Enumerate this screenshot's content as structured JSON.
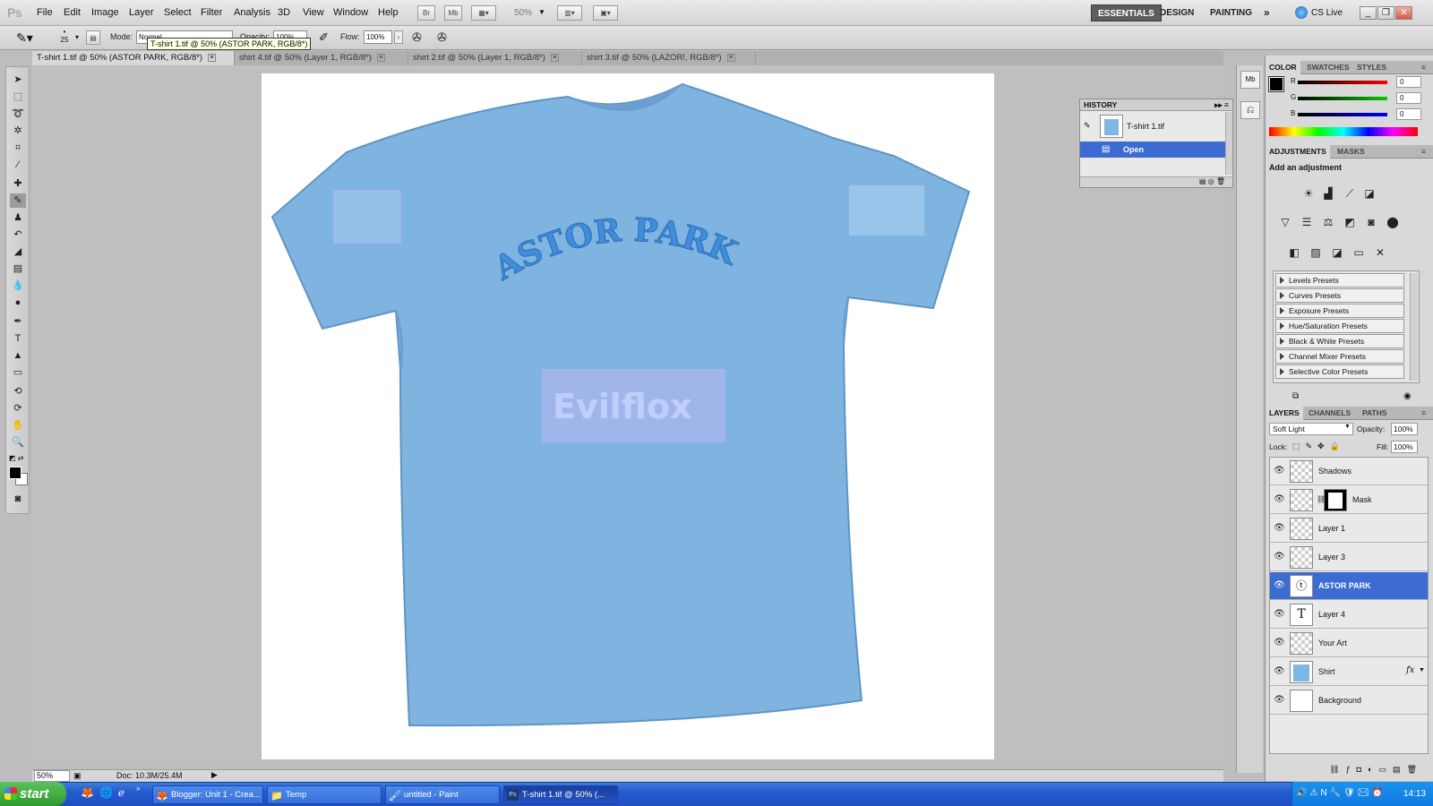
{
  "app": {
    "logo": "Ps"
  },
  "menu": [
    "File",
    "Edit",
    "Image",
    "Layer",
    "Select",
    "Filter",
    "Analysis",
    "3D",
    "View",
    "Window",
    "Help"
  ],
  "appbar": {
    "br": "Br",
    "mb": "Mb",
    "zoom": "50%"
  },
  "workspaces": [
    "ESSENTIALS",
    "DESIGN",
    "PAINTING",
    "»"
  ],
  "cslive": "CS Live",
  "options": {
    "brush_size": "25",
    "mode_label": "Mode:",
    "mode_value": "Normal",
    "opacity_label": "Opacity:",
    "opacity_value": "100%",
    "flow_label": "Flow:",
    "flow_value": "100%"
  },
  "tooltip": "T-shirt 1.tif @ 50% (ASTOR PARK, RGB/8*)",
  "doc_tabs": [
    {
      "label": "T-shirt 1.tif @ 50% (ASTOR PARK, RGB/8*)"
    },
    {
      "label": "shirt 4.tif @ 50% (Layer 1, RGB/8*)"
    },
    {
      "label": "shirt 2.tif @ 50% (Layer 1, RGB/8*)"
    },
    {
      "label": "shirt 3.tif @ 50% (LAZOR!, RGB/8*)"
    }
  ],
  "canvas": {
    "shirt_color": "#7fb6e2",
    "print_text": "ASTOR PARK"
  },
  "status": {
    "zoom": "50%",
    "doc": "Doc: 10.3M/25.4M"
  },
  "history": {
    "title": "HISTORY",
    "snapshot": "T-shirt 1.tif",
    "step": "Open"
  },
  "color_panel": {
    "tabs": [
      "COLOR",
      "SWATCHES",
      "STYLES"
    ],
    "r_label": "R",
    "g_label": "G",
    "b_label": "B",
    "r": "0",
    "g": "0",
    "b": "0"
  },
  "adjustments": {
    "tabs": [
      "ADJUSTMENTS",
      "MASKS"
    ],
    "heading": "Add an adjustment",
    "presets": [
      "Levels Presets",
      "Curves Presets",
      "Exposure Presets",
      "Hue/Saturation Presets",
      "Black & White Presets",
      "Channel Mixer Presets",
      "Selective Color Presets"
    ]
  },
  "layers_panel": {
    "tabs": [
      "LAYERS",
      "CHANNELS",
      "PATHS"
    ],
    "blend": "Soft Light",
    "opacity_label": "Opacity:",
    "opacity": "100%",
    "lock_label": "Lock:",
    "fill_label": "Fill:",
    "fill": "100%",
    "layers": [
      {
        "name": "Shadows"
      },
      {
        "name": "Mask"
      },
      {
        "name": "Layer 1"
      },
      {
        "name": "Layer 3"
      },
      {
        "name": "ASTOR PARK"
      },
      {
        "name": "Layer 4"
      },
      {
        "name": "Your Art"
      },
      {
        "name": "Shirt"
      },
      {
        "name": "Background"
      }
    ],
    "fx": "fx"
  },
  "taskbar": {
    "start": "start",
    "tasks": [
      "Blogger: Unit 1 - Crea...",
      "Temp",
      "untitled - Paint",
      "T-shirt 1.tif @ 50% (..."
    ],
    "clock": "14:13"
  },
  "colors": {
    "accent": "#3c6bd1",
    "taskbar": "#245ad0",
    "start": "#2e9a2e"
  }
}
